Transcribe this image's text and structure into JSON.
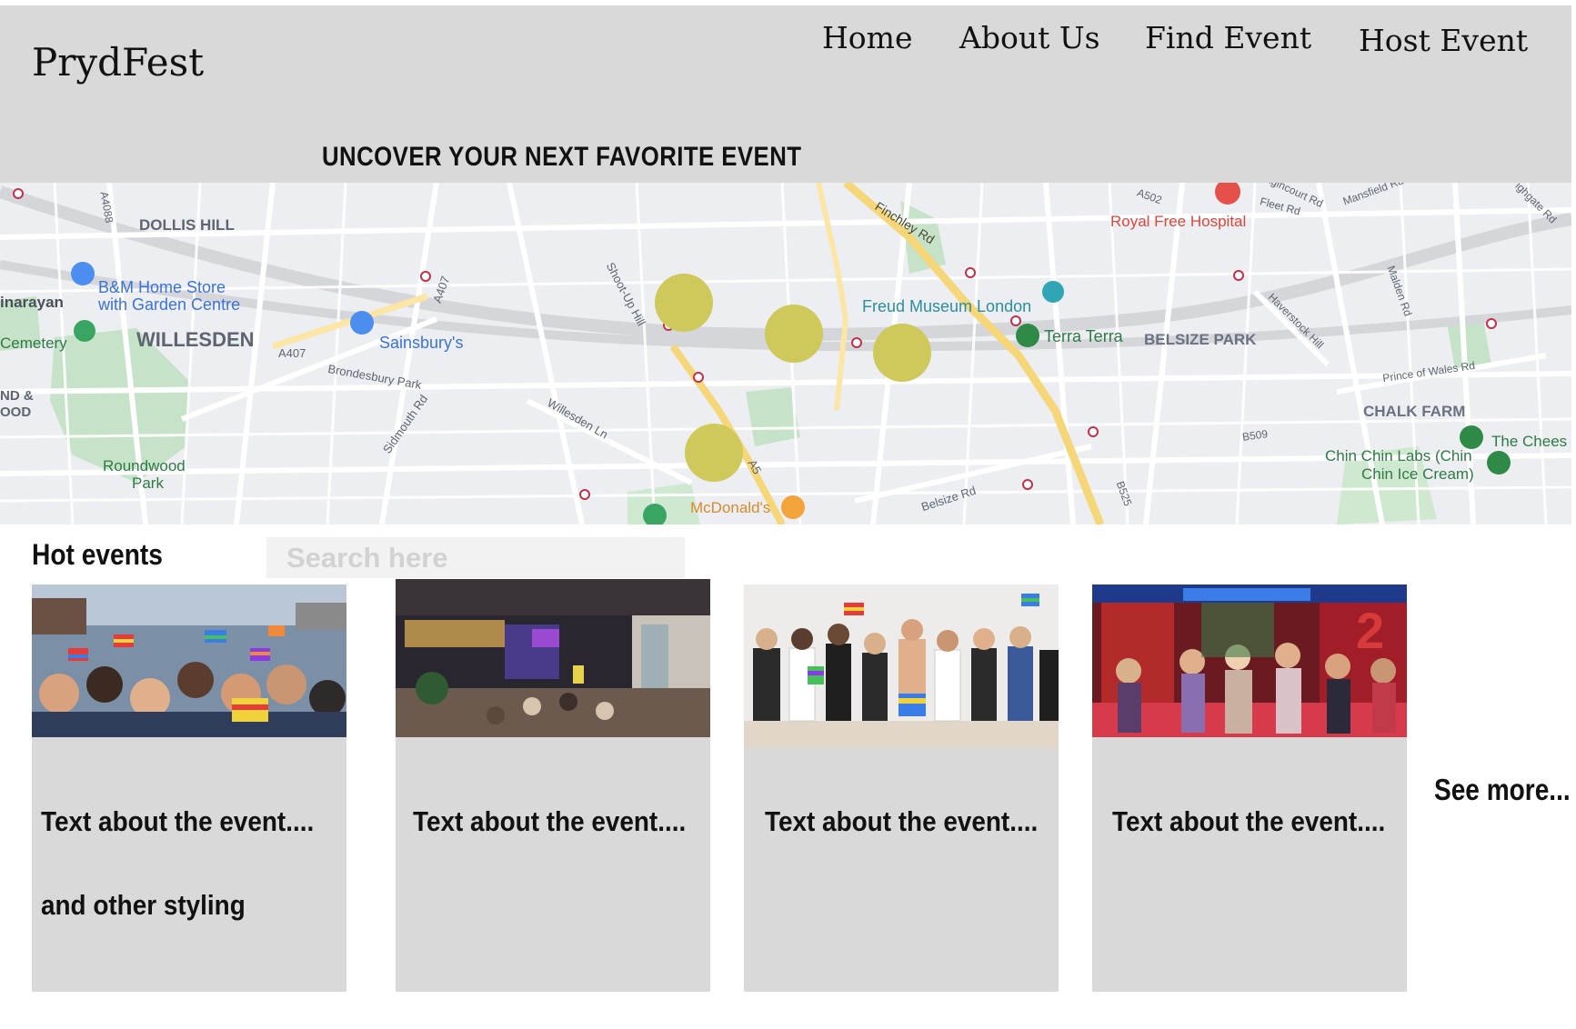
{
  "header": {
    "logo": "PrydFest",
    "nav": [
      "Home",
      "About Us",
      "Find Event",
      "Host Event"
    ],
    "tagline": "UNCOVER YOUR NEXT FAVORITE EVENT"
  },
  "map": {
    "labels": {
      "dollis_hill": "DOLLIS HILL",
      "bm_store_1": "B&M Home Store",
      "bm_store_2": "with Garden Centre",
      "inarayan": "inarayan",
      "willesden": "WILLESDEN",
      "cemetery": "Cemetery",
      "nd_line1": "ND &",
      "nd_line2": "OOD",
      "sainsburys": "Sainsbury's",
      "a407": "A407",
      "a407b": "A407",
      "brondesbury": "Brondesbury Park",
      "sidmouth": "Sidmouth Rd",
      "roundwood_1": "Roundwood",
      "roundwood_2": "Park",
      "shoot_up": "Shoot-Up Hill",
      "willesden_ln": "Willesden Ln",
      "a5": "A5",
      "mcdonalds": "McDonald's",
      "finchley": "Finchley Rd",
      "freud": "Freud Museum London",
      "terra": "Terra Terra",
      "belsize_park": "BELSIZE PARK",
      "belsize_rd": "Belsize Rd",
      "royal_free": "Royal Free Hospital",
      "a502": "A502",
      "fleet_rd": "Fleet Rd",
      "agincourt": "Agincourt Rd",
      "mansfield": "Mansfield Rd",
      "haverstock": "Haverstock Hill",
      "malden": "Malden Rd",
      "prince_wales": "Prince of Wales Rd",
      "chalk_farm": "CHALK FARM",
      "b509": "B509",
      "b525": "B525",
      "chin_1": "Chin Chin Labs (Chin",
      "chin_2": "Chin Ice Cream)",
      "the_chees": "The Chees",
      "a4088": "A4088",
      "highgate": "ighgate Rd"
    },
    "marker_color": "#cfc85a"
  },
  "events": {
    "title": "Hot events",
    "search_placeholder": "Search here",
    "cards": [
      {
        "text": "Text about the event....",
        "text2": "and other styling"
      },
      {
        "text": "Text about the event...."
      },
      {
        "text": "Text about the event...."
      },
      {
        "text": "Text about the event...."
      }
    ],
    "see_more": "See more..."
  }
}
